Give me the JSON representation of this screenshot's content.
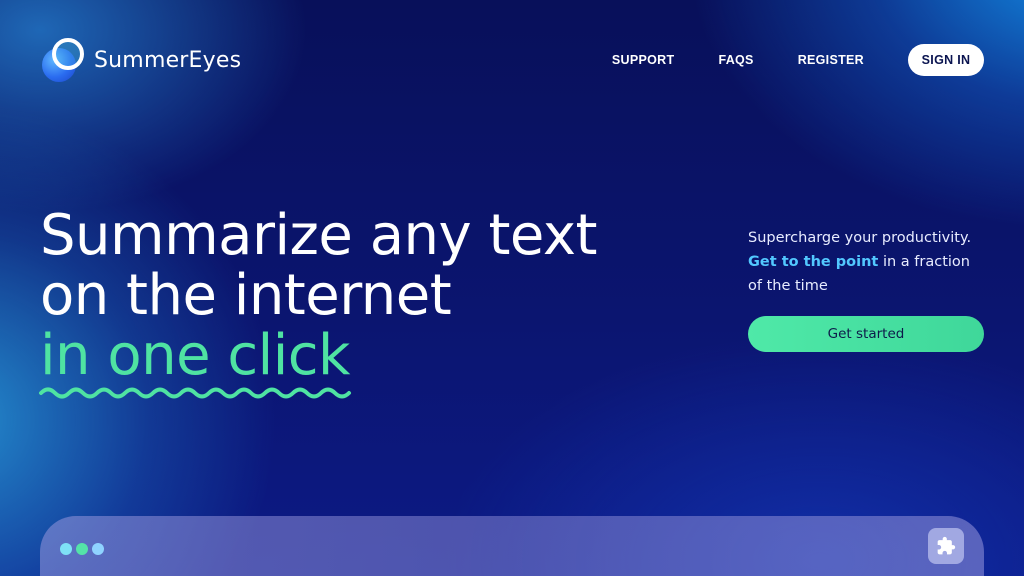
{
  "brand": {
    "name": "SummerEyes",
    "logo_icon": "eye-orb-logo"
  },
  "nav": {
    "items": [
      {
        "label": "SUPPORT"
      },
      {
        "label": "FAQS"
      },
      {
        "label": "REGISTER"
      }
    ],
    "signin_label": "SIGN IN"
  },
  "hero": {
    "title_line1": "Summarize any text",
    "title_line2": "on the internet",
    "title_accent": "in one click",
    "accent_color": "#4fe3a2"
  },
  "side": {
    "line1": "Supercharge your productivity.",
    "highlight": "Get to the point",
    "rest": " in a fraction of the time",
    "cta_label": "Get started",
    "highlight_color": "#52c8ff"
  },
  "mockup": {
    "window_dots": [
      "#7ee1f6",
      "#54e3a8",
      "#8fd3ff"
    ],
    "extension_icon": "puzzle-icon"
  }
}
